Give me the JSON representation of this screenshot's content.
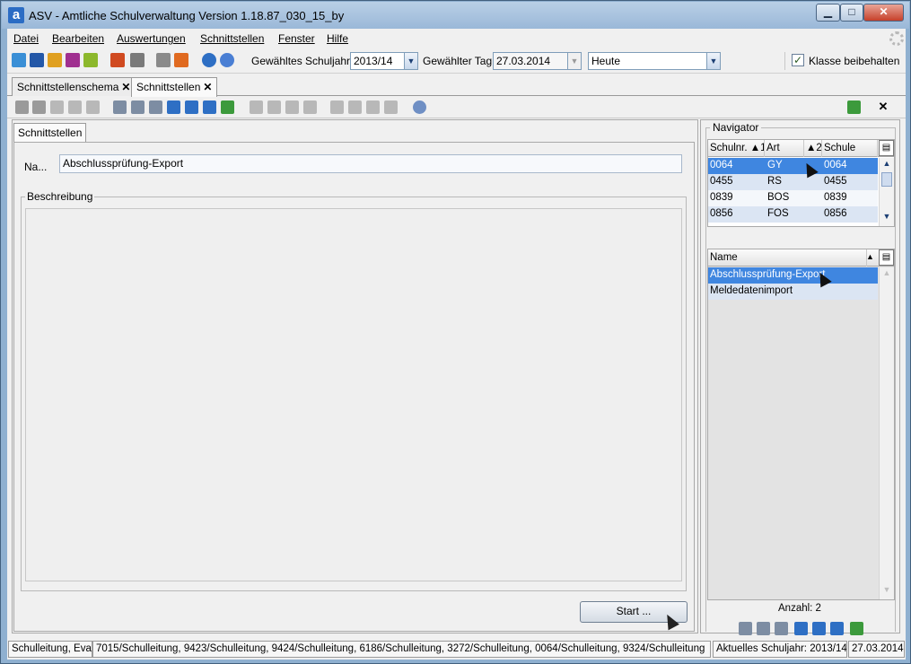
{
  "window": {
    "app_icon": "a",
    "title": "ASV - Amtliche Schulverwaltung Version 1.18.87_030_15_by",
    "minimize": "▁",
    "maximize": "□",
    "close": "✕"
  },
  "menu": [
    "Datei",
    "Bearbeiten",
    "Auswertungen",
    "Schnittstellen",
    "Fenster",
    "Hilfe"
  ],
  "toolbar": {
    "schuljahr_label": "Gewähltes Schuljahr",
    "schuljahr_value": "2013/14",
    "tag_label": "Gewählter Tag",
    "tag_value": "27.03.2014",
    "heute_value": "Heute",
    "klasse_label": "Klasse beibehalten",
    "klasse_checked": true
  },
  "tabs": [
    {
      "label": "Schnittstellenschema",
      "close": "✕"
    },
    {
      "label": "Schnittstellen",
      "close": "✕"
    }
  ],
  "subtoolbar_close": "✕",
  "detail": {
    "inner_tab": "Schnittstellen",
    "name_label": "Na...",
    "name_value": "Abschlussprüfung-Export",
    "description_label": "Beschreibung",
    "description_value": "",
    "start_button": "Start ..."
  },
  "navigator": {
    "title": "Navigator",
    "schools_columns": [
      "Schulnr. ▲1",
      "Art",
      "▲2",
      "Schule"
    ],
    "schools_rows": [
      {
        "schulnr": "0064",
        "art": "GY",
        "schule": "0064",
        "selected": true
      },
      {
        "schulnr": "0455",
        "art": "RS",
        "schule": "0455",
        "selected": false
      },
      {
        "schulnr": "0839",
        "art": "BOS",
        "schule": "0839",
        "selected": false
      },
      {
        "schulnr": "0856",
        "art": "FOS",
        "schule": "0856",
        "selected": false
      }
    ],
    "list_column": "Name",
    "list_sort": "▲",
    "list_rows": [
      {
        "name": "Abschlussprüfung-Export",
        "selected": true
      },
      {
        "name": "Meldedatenimport",
        "selected": false
      }
    ],
    "count_label": "Anzahl: 2"
  },
  "statusbar": {
    "user": "Schulleitung, Eva",
    "roles": "7015/Schulleitung, 9423/Schulleitung, 9424/Schulleitung, 6186/Schulleitung, 3272/Schulleitung, 0064/Schulleitung, 9324/Schulleitung",
    "schuljahr": "Aktuelles Schuljahr: 2013/14",
    "date": "27.03.2014"
  },
  "colors": {
    "selection": "#3f86e0",
    "row_alt": "#dbe5f3",
    "accent": "#2b6cc4"
  }
}
